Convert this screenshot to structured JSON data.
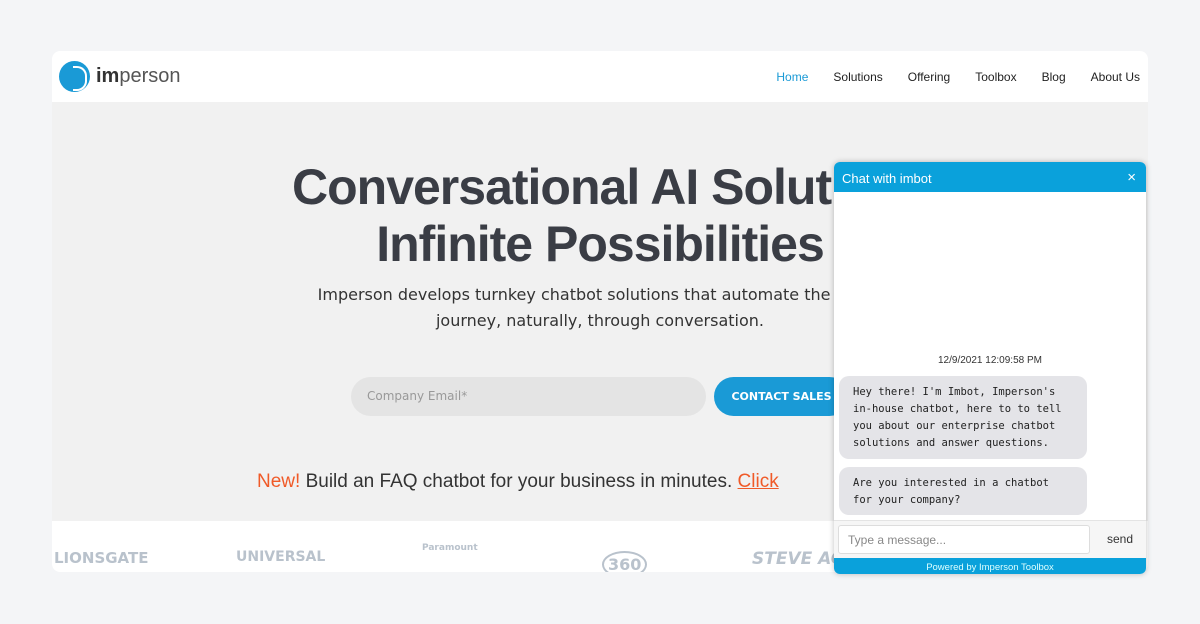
{
  "brand": {
    "name_bold": "im",
    "name_rest": "person"
  },
  "nav": {
    "items": [
      "Home",
      "Solutions",
      "Offering",
      "Toolbox",
      "Blog",
      "About Us"
    ],
    "active": "Home"
  },
  "hero": {
    "title_line1": "Conversational AI Solutio",
    "title_line2": "Infinite Possibilities",
    "subtitle_line1": "Imperson develops turnkey chatbot solutions that automate the entire",
    "subtitle_line2": "journey, naturally, through conversation.",
    "email_placeholder": "Company Email*",
    "cta": "CONTACT SALES",
    "faq_new": "New!",
    "faq_text": " Build an FAQ chatbot for your business in minutes. ",
    "faq_link": "Click"
  },
  "logos": [
    "LIONSGATE",
    "UNIVERSAL",
    "Paramount",
    "360",
    "STEVE AOKI"
  ],
  "chat": {
    "title": "Chat with imbot",
    "close": "×",
    "timestamp": "12/9/2021 12:09:58 PM",
    "messages": [
      "Hey there! I'm Imbot, Imperson's in-house chatbot, here to to tell you about our enterprise chatbot solutions and answer questions.",
      "Are you interested in a chatbot for your company?"
    ],
    "input_placeholder": "Type a message...",
    "send": "send",
    "powered": "Powered by Imperson Toolbox"
  },
  "colors": {
    "accent": "#1a9ad6",
    "chat_header": "#0aa1db",
    "highlight": "#f05a28"
  }
}
